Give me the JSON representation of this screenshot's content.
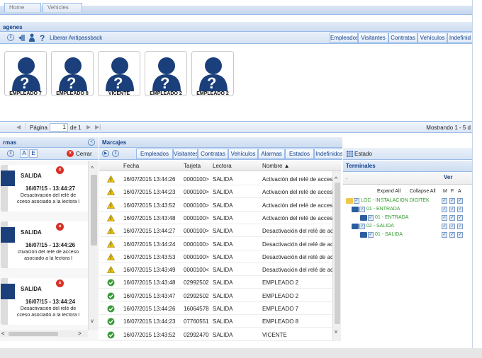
{
  "top_tabs": [
    "Home",
    "Vehicles"
  ],
  "imagenes": {
    "title": "agenes",
    "toolbar_action": "Liberar Antipassback",
    "filter_tabs": [
      "Empleados",
      "Visitantes",
      "Contratas",
      "Vehículos",
      "Indefinid"
    ],
    "cards": [
      {
        "label": "EMPLEADO 7"
      },
      {
        "label": "EMPLEADO 8"
      },
      {
        "label": "VICENTE"
      },
      {
        "label": "EMPLEADO 2"
      },
      {
        "label": "EMPLEADO 2"
      }
    ],
    "pager": {
      "page_label": "Página",
      "page_value": "1",
      "of_label": "de 1",
      "summary": "Mostrando 1 - 5 d"
    }
  },
  "alarmas": {
    "title": "rmas",
    "buttons": [
      "A",
      "E"
    ],
    "close_label": "Cerrar",
    "items": [
      {
        "status": "SALIDA",
        "time": "16/07/15 - 13:44:27",
        "line1": "Desactivación del relé de",
        "line2": "cceso asociado a la lectora l"
      },
      {
        "status": "SALIDA",
        "time": "16/07/15 - 13:44:26",
        "line1": "ctivación del relé de acceso",
        "line2": "asociado a la lectora l"
      },
      {
        "status": "SALIDA",
        "time": "16/07/15 - 13:44:24",
        "line1": "Desactivación del relé de",
        "line2": "cceso asociado a la lectora l"
      }
    ]
  },
  "marcajes": {
    "title": "Marcajes",
    "filter_tabs": [
      "Empleados",
      "Visitantes",
      "Contratas",
      "Vehículos",
      "Alarmas",
      "Estados",
      "Indefinidos"
    ],
    "columns": [
      "Fecha",
      "Tarjeta",
      "Lectora",
      "Nombre ▲"
    ],
    "rows": [
      {
        "icon": "warning",
        "fecha": "16/07/2015 13:44:26",
        "tarjeta": "0000100>",
        "lectora": "SALIDA",
        "nombre": "Activación del relé de acceso"
      },
      {
        "icon": "warning",
        "fecha": "16/07/2015 13:44:23",
        "tarjeta": "0000100>",
        "lectora": "SALIDA",
        "nombre": "Activación del relé de acceso"
      },
      {
        "icon": "warning",
        "fecha": "16/07/2015 13:43:52",
        "tarjeta": "0000100>",
        "lectora": "SALIDA",
        "nombre": "Activación del relé de acceso"
      },
      {
        "icon": "warning",
        "fecha": "16/07/2015 13:43:48",
        "tarjeta": "0000100>",
        "lectora": "SALIDA",
        "nombre": "Activación del relé de acceso"
      },
      {
        "icon": "warning",
        "fecha": "16/07/2015 13:44:27",
        "tarjeta": "0000100>",
        "lectora": "SALIDA",
        "nombre": "Desactivación del relé de acc"
      },
      {
        "icon": "warning",
        "fecha": "16/07/2015 13:44:24",
        "tarjeta": "0000100>",
        "lectora": "SALIDA",
        "nombre": "Desactivación del relé de acc"
      },
      {
        "icon": "warning",
        "fecha": "16/07/2015 13:43:53",
        "tarjeta": "0000100>",
        "lectora": "SALIDA",
        "nombre": "Desactivación del relé de acc"
      },
      {
        "icon": "warning",
        "fecha": "16/07/2015 13:43:49",
        "tarjeta": "0000100<",
        "lectora": "SALIDA",
        "nombre": "Desactivación del relé de acc"
      },
      {
        "icon": "ok",
        "fecha": "16/07/2015 13:43:48",
        "tarjeta": "02992502",
        "lectora": "SALIDA",
        "nombre": "EMPLEADO 2"
      },
      {
        "icon": "ok",
        "fecha": "16/07/2015 13:43:47",
        "tarjeta": "02992502",
        "lectora": "SALIDA",
        "nombre": "EMPLEADO 2"
      },
      {
        "icon": "ok",
        "fecha": "16/07/2015 13:44:26",
        "tarjeta": "16064578",
        "lectora": "SALIDA",
        "nombre": "EMPLEADO 7"
      },
      {
        "icon": "ok",
        "fecha": "16/07/2015 13:44:23",
        "tarjeta": "07760551",
        "lectora": "SALIDA",
        "nombre": "EMPLEADO 8"
      },
      {
        "icon": "ok",
        "fecha": "16/07/2015 13:43:52",
        "tarjeta": "02992470",
        "lectora": "SALIDA",
        "nombre": "VICENTE"
      }
    ]
  },
  "terminales": {
    "estado_label": "Estado",
    "title": "Terminales",
    "col_dot": ".",
    "ver_label": "Ver",
    "expand_all": "Expand All",
    "collapse_all": "Collapse All",
    "flags": [
      "M",
      "F",
      "A"
    ],
    "tree": [
      {
        "label": "LOC - INSTALACION DIGITEK"
      },
      {
        "label": "01 - ENTRADA"
      },
      {
        "label": "01 - ENTRADA"
      },
      {
        "label": "02 - SALIDA"
      },
      {
        "label": "01 - SALIDA"
      }
    ]
  },
  "colors": {
    "accent": "#15428b",
    "warning": "#f2c500",
    "ok": "#3a9a3a",
    "error": "#d93025",
    "tree_green": "#2e9a2e"
  }
}
